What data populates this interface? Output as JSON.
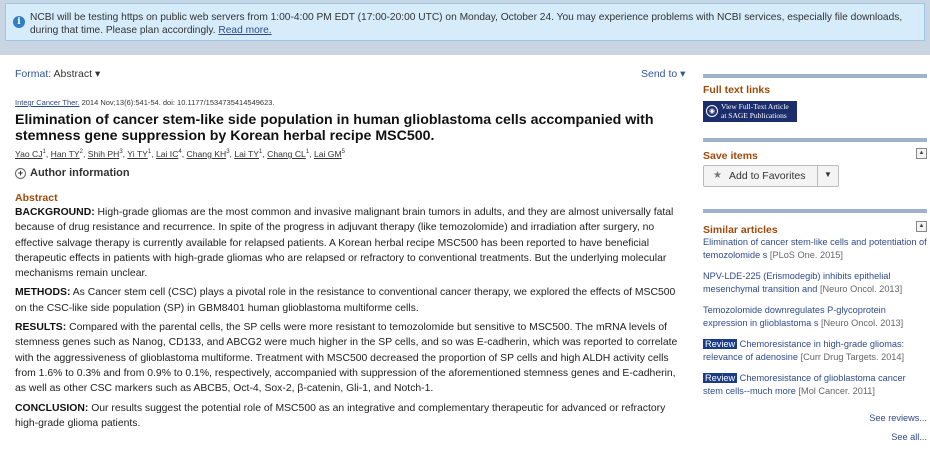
{
  "banner": {
    "text": "NCBI will be testing https on public web servers from 1:00-4:00 PM EDT (17:00-20:00 UTC) on Monday, October 24. You may experience problems with NCBI services, especially file downloads, during that time. Please plan accordingly.",
    "link": "Read more."
  },
  "toolbar": {
    "format_label": "Format:",
    "format_value": "Abstract",
    "send_to": "Send to"
  },
  "article": {
    "journal": "Integr Cancer Ther.",
    "citation": " 2014 Nov;13(6):541-54. doi: 10.1177/1534735414549623.",
    "title": "Elimination of cancer stem-like side population in human glioblastoma cells accompanied with stemness gene suppression by Korean herbal recipe MSC500.",
    "authors": [
      {
        "name": "Yao CJ",
        "sup": "1"
      },
      {
        "name": "Han TY",
        "sup": "2"
      },
      {
        "name": "Shih PH",
        "sup": "3"
      },
      {
        "name": "Yi TY",
        "sup": "1"
      },
      {
        "name": "Lai IC",
        "sup": "4"
      },
      {
        "name": "Chang KH",
        "sup": "3"
      },
      {
        "name": "Lai TY",
        "sup": "1"
      },
      {
        "name": "Chang CL",
        "sup": "1"
      },
      {
        "name": "Lai GM",
        "sup": "5"
      }
    ],
    "author_info": "Author information",
    "abstract_heading": "Abstract",
    "abstract": [
      {
        "label": "BACKGROUND:",
        "text": " High-grade gliomas are the most common and invasive malignant brain tumors in adults, and they are almost universally fatal because of drug resistance and recurrence. In spite of the progress in adjuvant therapy (like temozolomide) and irradiation after surgery, no effective salvage therapy is currently available for relapsed patients. A Korean herbal recipe MSC500 has been reported to have beneficial therapeutic effects in patients with high-grade gliomas who are relapsed or refractory to conventional treatments. But the underlying molecular mechanisms remain unclear."
      },
      {
        "label": "METHODS:",
        "text": " As Cancer stem cell (CSC) plays a pivotal role in the resistance to conventional cancer therapy, we explored the effects of MSC500 on the CSC-like side population (SP) in GBM8401 human glioblastoma multiforme cells."
      },
      {
        "label": "RESULTS:",
        "text": " Compared with the parental cells, the SP cells were more resistant to temozolomide but sensitive to MSC500. The mRNA levels of stemness genes such as Nanog, CD133, and ABCG2 were much higher in the SP cells, and so was E-cadherin, which was reported to correlate with the aggressiveness of glioblastoma multiforme. Treatment with MSC500 decreased the proportion of SP cells and high ALDH activity cells from 1.6% to 0.3% and from 0.9% to 0.1%, respectively, accompanied with suppression of the aforementioned stemness genes and E-cadherin, as well as other CSC markers such as ABCB5, Oct-4, Sox-2, β-catenin, Gli-1, and Notch-1."
      },
      {
        "label": "CONCLUSION:",
        "text": " Our results suggest the potential role of MSC500 as an integrative and complementary therapeutic for advanced or refractory high-grade glioma patients."
      }
    ]
  },
  "sidebar": {
    "full_text": {
      "heading": "Full text links",
      "badge_line1": "View Full-Text Article",
      "badge_line2": "at SAGE Publications"
    },
    "save": {
      "heading": "Save items",
      "add_favorites": "Add to Favorites"
    },
    "similar": {
      "heading": "Similar articles",
      "items": [
        {
          "badge": "",
          "text": "Elimination of cancer stem-like cells and potentiation of temozolomide s",
          "meta": "[PLoS One. 2015]"
        },
        {
          "badge": "",
          "text": "NPV-LDE-225 (Erismodegib) inhibits epithelial mesenchymal transition and",
          "meta": "[Neuro Oncol. 2013]"
        },
        {
          "badge": "",
          "text": "Temozolomide downregulates P-glycoprotein expression in glioblastoma s",
          "meta": "[Neuro Oncol. 2013]"
        },
        {
          "badge": "Review",
          "text": " Chemoresistance in high-grade gliomas: relevance of adenosine",
          "meta": "[Curr Drug Targets. 2014]"
        },
        {
          "badge": "Review",
          "text": " Chemoresistance of glioblastoma cancer stem cells--much more",
          "meta": "[Mol Cancer. 2011]"
        }
      ],
      "see_reviews": "See reviews...",
      "see_all": "See all..."
    }
  }
}
